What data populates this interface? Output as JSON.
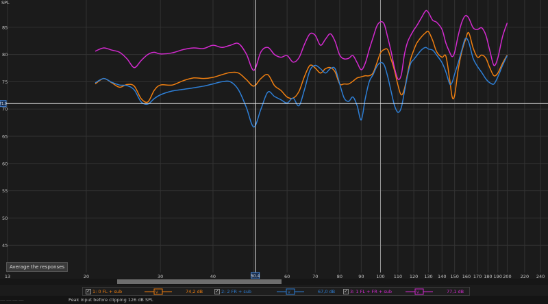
{
  "chart_data": {
    "type": "line",
    "ylabel": "SPL",
    "ylim": [
      40,
      90
    ],
    "yticks": [
      45,
      50,
      55,
      60,
      65,
      70,
      75,
      80,
      85
    ],
    "xlim": [
      13,
      250
    ],
    "xscale": "log",
    "xticks": [
      13,
      20,
      30,
      40,
      50,
      60,
      70,
      80,
      90,
      100,
      110,
      120,
      130,
      140,
      150,
      160,
      170,
      180,
      190,
      200,
      220,
      240
    ],
    "grid": true,
    "legend_placement": "bottom",
    "cursor": {
      "x": 50.4,
      "x_label": "50.4",
      "y": 71.0,
      "y_label": "71.0"
    },
    "series": [
      {
        "name": "1: 0 FL + sub",
        "color": "#f07f10",
        "points": [
          [
            21,
            74.6
          ],
          [
            22,
            75.6
          ],
          [
            23,
            74.8
          ],
          [
            24,
            74
          ],
          [
            25,
            74.5
          ],
          [
            26,
            74.2
          ],
          [
            27,
            71.9
          ],
          [
            28,
            71.3
          ],
          [
            29,
            73.4
          ],
          [
            30,
            74.4
          ],
          [
            32,
            74.4
          ],
          [
            34,
            75.2
          ],
          [
            36,
            75.7
          ],
          [
            38,
            75.6
          ],
          [
            40,
            75.8
          ],
          [
            42,
            76.3
          ],
          [
            44,
            76.7
          ],
          [
            46,
            76.6
          ],
          [
            48,
            75.4
          ],
          [
            50,
            74.2
          ],
          [
            52,
            75.6
          ],
          [
            54,
            76.3
          ],
          [
            56,
            74.3
          ],
          [
            58,
            73.4
          ],
          [
            60,
            72.2
          ],
          [
            62,
            72
          ],
          [
            64,
            73.2
          ],
          [
            66,
            76
          ],
          [
            68,
            78
          ],
          [
            70,
            77.5
          ],
          [
            72,
            76.6
          ],
          [
            74,
            77.4
          ],
          [
            76,
            77.6
          ],
          [
            78,
            76.8
          ],
          [
            80,
            74.6
          ],
          [
            82,
            74.6
          ],
          [
            84,
            74.6
          ],
          [
            86,
            75.1
          ],
          [
            88,
            75.7
          ],
          [
            90,
            75.9
          ],
          [
            92,
            76.1
          ],
          [
            94,
            76.1
          ],
          [
            96,
            76.6
          ],
          [
            98,
            78.4
          ],
          [
            100,
            80.3
          ],
          [
            102,
            80.9
          ],
          [
            104,
            80.9
          ],
          [
            106,
            79.1
          ],
          [
            108,
            77
          ],
          [
            110,
            74.4
          ],
          [
            112,
            72.6
          ],
          [
            114,
            73.7
          ],
          [
            116,
            76.6
          ],
          [
            118,
            79.2
          ],
          [
            120,
            80.8
          ],
          [
            122,
            82.1
          ],
          [
            125,
            83.2
          ],
          [
            128,
            84
          ],
          [
            130,
            84.2
          ],
          [
            133,
            82.6
          ],
          [
            136,
            80.5
          ],
          [
            140,
            79.5
          ],
          [
            143,
            79.7
          ],
          [
            146,
            75.4
          ],
          [
            148,
            72.2
          ],
          [
            150,
            72.5
          ],
          [
            153,
            77.3
          ],
          [
            156,
            80.5
          ],
          [
            159,
            82.6
          ],
          [
            162,
            84
          ],
          [
            166,
            81.2
          ],
          [
            170,
            79.5
          ],
          [
            174,
            79.9
          ],
          [
            178,
            79.3
          ],
          [
            182,
            77.5
          ],
          [
            186,
            76.1
          ],
          [
            190,
            76.6
          ],
          [
            195,
            78.4
          ],
          [
            200,
            79.9
          ]
        ]
      },
      {
        "name": "2: 2 FR + sub",
        "color": "#2e7fd6",
        "points": [
          [
            21,
            74.8
          ],
          [
            22,
            75.6
          ],
          [
            23,
            74.9
          ],
          [
            24,
            74.4
          ],
          [
            25,
            74.3
          ],
          [
            26,
            73.5
          ],
          [
            27,
            71.3
          ],
          [
            28,
            70.9
          ],
          [
            29,
            71.9
          ],
          [
            30,
            72.6
          ],
          [
            32,
            73.3
          ],
          [
            34,
            73.6
          ],
          [
            36,
            73.9
          ],
          [
            38,
            74.2
          ],
          [
            40,
            74.6
          ],
          [
            42,
            75
          ],
          [
            44,
            75
          ],
          [
            46,
            73.5
          ],
          [
            48,
            70.3
          ],
          [
            50,
            66.7
          ],
          [
            52,
            70
          ],
          [
            54,
            73.1
          ],
          [
            56,
            72.3
          ],
          [
            58,
            71.7
          ],
          [
            60,
            71.1
          ],
          [
            62,
            72
          ],
          [
            64,
            70.6
          ],
          [
            66,
            73.6
          ],
          [
            68,
            77.1
          ],
          [
            70,
            78
          ],
          [
            72,
            77.4
          ],
          [
            74,
            76.6
          ],
          [
            76,
            77.4
          ],
          [
            78,
            77.4
          ],
          [
            80,
            74.6
          ],
          [
            82,
            72
          ],
          [
            84,
            71.4
          ],
          [
            86,
            72.2
          ],
          [
            88,
            70.6
          ],
          [
            90,
            68
          ],
          [
            92,
            71.9
          ],
          [
            94,
            75
          ],
          [
            96,
            76.3
          ],
          [
            98,
            77.8
          ],
          [
            100,
            78.5
          ],
          [
            102,
            78.1
          ],
          [
            104,
            76
          ],
          [
            106,
            73.2
          ],
          [
            108,
            70.6
          ],
          [
            110,
            69.4
          ],
          [
            112,
            70.2
          ],
          [
            114,
            73.2
          ],
          [
            116,
            76.2
          ],
          [
            118,
            78.4
          ],
          [
            120,
            79.1
          ],
          [
            122,
            79.8
          ],
          [
            125,
            80.8
          ],
          [
            128,
            81.3
          ],
          [
            130,
            81
          ],
          [
            133,
            80.8
          ],
          [
            136,
            79.9
          ],
          [
            140,
            78.5
          ],
          [
            143,
            76.8
          ],
          [
            146,
            74.6
          ],
          [
            148,
            74.9
          ],
          [
            150,
            76.4
          ],
          [
            153,
            78.5
          ],
          [
            156,
            80.8
          ],
          [
            159,
            82.9
          ],
          [
            162,
            82.3
          ],
          [
            166,
            79.3
          ],
          [
            170,
            77.8
          ],
          [
            174,
            76.7
          ],
          [
            178,
            75.5
          ],
          [
            182,
            74.8
          ],
          [
            186,
            74.6
          ],
          [
            190,
            75.9
          ],
          [
            195,
            78
          ],
          [
            200,
            79.8
          ]
        ]
      },
      {
        "name": "3: 1 FL + FR + sub",
        "color": "#d42ad0",
        "points": [
          [
            21,
            80.6
          ],
          [
            22,
            81.2
          ],
          [
            23,
            80.8
          ],
          [
            24,
            80.4
          ],
          [
            25,
            79.2
          ],
          [
            26,
            77.6
          ],
          [
            27,
            78.9
          ],
          [
            28,
            80
          ],
          [
            29,
            80.4
          ],
          [
            30,
            80.1
          ],
          [
            32,
            80.3
          ],
          [
            34,
            80.9
          ],
          [
            36,
            81.2
          ],
          [
            38,
            81.1
          ],
          [
            40,
            81.7
          ],
          [
            42,
            81.3
          ],
          [
            44,
            81.7
          ],
          [
            46,
            82
          ],
          [
            48,
            80.1
          ],
          [
            50,
            77.1
          ],
          [
            52,
            80.5
          ],
          [
            54,
            81.3
          ],
          [
            56,
            80
          ],
          [
            58,
            79.5
          ],
          [
            60,
            79.8
          ],
          [
            62,
            78.6
          ],
          [
            64,
            79.4
          ],
          [
            66,
            81.9
          ],
          [
            68,
            83.8
          ],
          [
            70,
            83.5
          ],
          [
            72,
            81.7
          ],
          [
            74,
            82.8
          ],
          [
            76,
            83.8
          ],
          [
            78,
            82.4
          ],
          [
            80,
            79.9
          ],
          [
            82,
            79.2
          ],
          [
            84,
            79.3
          ],
          [
            86,
            79.8
          ],
          [
            88,
            78.5
          ],
          [
            90,
            77.2
          ],
          [
            92,
            78.4
          ],
          [
            94,
            80.9
          ],
          [
            96,
            83.1
          ],
          [
            98,
            85.2
          ],
          [
            100,
            86
          ],
          [
            102,
            85.6
          ],
          [
            104,
            83.2
          ],
          [
            106,
            80.5
          ],
          [
            108,
            77.5
          ],
          [
            110,
            75.5
          ],
          [
            112,
            76.2
          ],
          [
            114,
            80
          ],
          [
            116,
            82.3
          ],
          [
            118,
            83.5
          ],
          [
            120,
            84.5
          ],
          [
            122,
            85.3
          ],
          [
            125,
            86.7
          ],
          [
            128,
            88
          ],
          [
            130,
            87.7
          ],
          [
            133,
            86.3
          ],
          [
            136,
            85.9
          ],
          [
            140,
            84.6
          ],
          [
            143,
            82.1
          ],
          [
            146,
            80.4
          ],
          [
            148,
            79.6
          ],
          [
            150,
            80.4
          ],
          [
            153,
            83.5
          ],
          [
            156,
            85.9
          ],
          [
            159,
            87.1
          ],
          [
            162,
            86.7
          ],
          [
            166,
            84.9
          ],
          [
            170,
            84.6
          ],
          [
            174,
            84.9
          ],
          [
            178,
            83.5
          ],
          [
            182,
            80.6
          ],
          [
            186,
            78
          ],
          [
            190,
            79.4
          ],
          [
            195,
            83.3
          ],
          [
            200,
            85.8
          ]
        ]
      }
    ]
  },
  "ui": {
    "y_axis_title": "SPL",
    "average_button": "Average the responses",
    "legend": [
      {
        "label": "1: 0 FL + sub",
        "value": "74,2 dB",
        "color": "#f07f10"
      },
      {
        "label": "2: 2 FR + sub",
        "value": "67,0 dB",
        "color": "#2e7fd6"
      },
      {
        "label": "3: 1 FL + FR + sub",
        "value": "77,1 dB",
        "color": "#d42ad0"
      }
    ],
    "status_dashes": "---- ---- ---- ----",
    "status_text": "Peak input before clipping 126 dB SPL"
  }
}
